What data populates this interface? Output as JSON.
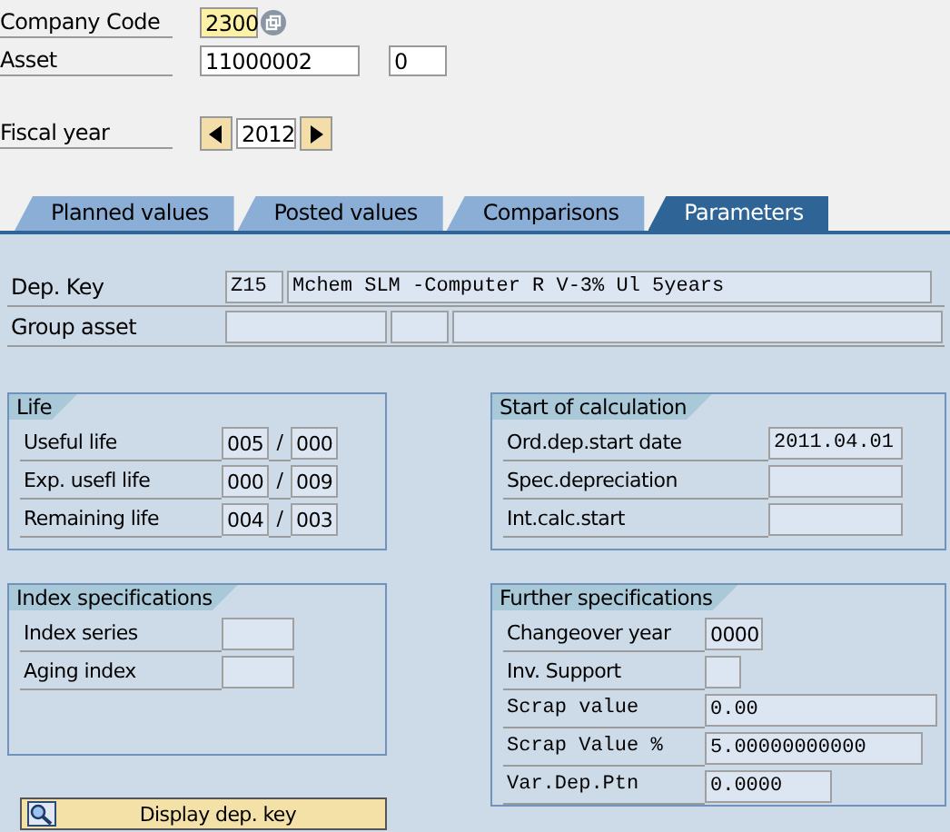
{
  "header": {
    "company_code": {
      "label": "Company Code",
      "value": "2300"
    },
    "asset": {
      "label": "Asset",
      "value": "11000002",
      "sub_number": "0"
    },
    "fiscal_year": {
      "label": "Fiscal year",
      "value": "2012"
    }
  },
  "tabs": [
    {
      "label": "Planned values",
      "selected": false
    },
    {
      "label": "Posted values",
      "selected": false
    },
    {
      "label": "Comparisons",
      "selected": false
    },
    {
      "label": "Parameters",
      "selected": true
    }
  ],
  "dep_key": {
    "label": "Dep. Key",
    "code": "Z15",
    "description": "Mchem SLM -Computer R V-3% Ul 5years"
  },
  "group_asset": {
    "label": "Group asset"
  },
  "life": {
    "title": "Life",
    "rows": [
      {
        "label": "Useful life",
        "years": "005",
        "separator": "/",
        "periods": "000"
      },
      {
        "label": "Exp. usefl life",
        "years": "000",
        "separator": "/",
        "periods": "009"
      },
      {
        "label": "Remaining life",
        "years": "004",
        "separator": "/",
        "periods": "003"
      }
    ]
  },
  "start_of_calculation": {
    "title": "Start of calculation",
    "rows": [
      {
        "label": "Ord.dep.start date",
        "value": "2011.04.01"
      },
      {
        "label": "Spec.depreciation"
      },
      {
        "label": "Int.calc.start"
      }
    ]
  },
  "index_specifications": {
    "title": "Index specifications",
    "rows": [
      {
        "label": "Index series"
      },
      {
        "label": "Aging index"
      }
    ]
  },
  "further_specifications": {
    "title": "Further specifications",
    "rows": [
      {
        "label": "Changeover year",
        "value": "0000"
      },
      {
        "label": "Inv. Support"
      },
      {
        "label": "Scrap value",
        "value": "0.00"
      },
      {
        "label": "Scrap Value %",
        "value": "5.00000000000"
      },
      {
        "label": "Var.Dep.Ptn",
        "value": "0.0000"
      }
    ]
  },
  "display_button": {
    "label": "Display dep. key"
  }
}
